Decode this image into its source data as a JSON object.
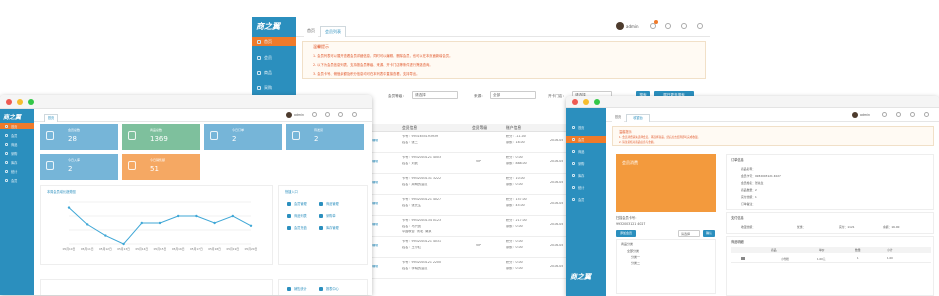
{
  "colors": {
    "sidebar": "#2b8fbe",
    "accent": "#ef7a2a",
    "blue": "#76b5d8",
    "green": "#7ec09d",
    "orange": "#f5a863",
    "red_note": "#e0572a"
  },
  "brand": "商之翼",
  "nav": [
    "首页",
    "会员",
    "商品",
    "采购",
    "库存",
    "统计",
    "会员"
  ],
  "user": "admin",
  "backwin": {
    "tabs": [
      "首页",
      "会员列表"
    ],
    "notice_title": "温馨提示",
    "notes": [
      "1. 会员列表可以展开查看会员详细信息，同时可以编辑、删除会员，也可以在本页面新增会员。",
      "2. 以下为会员信息列表，支持按会员等级、来源、开卡门店等条件进行筛选查询。",
      "3. 会员卡号、储值余额及积分信息均可在本列表中直接查看，支持导出。"
    ],
    "filters": [
      {
        "label": "会员等级：",
        "value": "请选择"
      },
      {
        "label": "来源：",
        "value": "全部"
      },
      {
        "label": "开卡门店：",
        "value": "请选择"
      }
    ],
    "search_btn": "搜索",
    "export_btn": "展开更多搜索",
    "col_headers": [
      "会员信息",
      "会员等级",
      "账户信息"
    ],
    "rows": [
      {
        "op": "编辑",
        "l1": "卡号：9931655193939",
        "l2": "姓名：张三",
        "lvl": "",
        "a1": "积分：-11.00",
        "a2": "余额：18.00",
        "t": "2016-05"
      },
      {
        "op": "编辑",
        "l1": "卡号：9932003121 4003",
        "l2": "姓名：刘武",
        "lvl": "VIP",
        "a1": "积分：0.00",
        "a2": "余额：888.00",
        "t": "2016-05"
      },
      {
        "op": "编辑",
        "l1": "卡号：9932003131 3222",
        "l2": "姓名：周明的会员",
        "lvl": "",
        "a1": "积分：10.00",
        "a2": "余额：0.00",
        "t": "2016-05"
      },
      {
        "op": "编辑",
        "l1": "卡号：9932003121 4027",
        "l2": "姓名：张先生",
        "lvl": "",
        "a1": "积分：157.00",
        "a2": "余额：45.00",
        "t": "2016-05"
      },
      {
        "op": "编辑",
        "l1": "卡号：9932003134 0123",
        "l2": "姓名：马兴武",
        "lvl": "",
        "a1": "积分：217.00",
        "a2": "余额：0.00",
        "t": "2016-05"
      },
      {
        "op": "编辑",
        "l1": "卡号：9932003121 4031",
        "l2": "姓名：王小红",
        "lvl": "VIP",
        "a1": "积分：0.00",
        "a2": "余额：0.00",
        "t": "2016-05"
      },
      {
        "op": "编辑",
        "l1": "卡号：9932003121 2200",
        "l2": "姓名：李晓的会员",
        "lvl": "",
        "a1": "积分：0.00",
        "a2": "余额：0.00",
        "t": "2016-05"
      }
    ],
    "extra_cells": [
      "中国联合",
      "河北",
      "南京"
    ]
  },
  "leftwin": {
    "tab": "首页",
    "cards": [
      {
        "label": "会员总数",
        "value": "28",
        "color": "#76b5d8"
      },
      {
        "label": "商品总数",
        "value": "1369",
        "color": "#7ec09d"
      },
      {
        "label": "今日订单",
        "value": "2",
        "color": "#76b5d8"
      },
      {
        "label": "待发货",
        "value": "2",
        "color": "#76b5d8"
      },
      {
        "label": "今日入库",
        "value": "2",
        "color": "#76b5d8"
      },
      {
        "label": "今日销售额",
        "value": "51",
        "color": "#f5a863"
      }
    ],
    "chart_title": "本周会员增长趋势图",
    "quick_title": "快捷入口",
    "quick": [
      [
        "会员管理",
        "商品管理"
      ],
      [
        "商品列表",
        "采购单"
      ],
      [
        "会员充值",
        "库存管理"
      ]
    ],
    "quick2": [
      "销售统计",
      "报表中心"
    ]
  },
  "rightwin": {
    "tabs": [
      "首页",
      "收银台"
    ],
    "notice_title": "温馨提示",
    "notes": [
      "1. 会员消费请先选择会员，再选择商品，然后点击结算即可完成收银。",
      "2. 请注意核对商品信息与金额。"
    ],
    "orange_label": "会员消费",
    "scan_label": "扫描会员卡号：",
    "card_no": "9932003121 4027",
    "small_btn": "添加会员",
    "goods_btn": "确认",
    "goods_sel": "请选择",
    "tree_title": "商品分类",
    "tree": [
      "全部分类",
      "分类一",
      "分类二"
    ],
    "info_title": "订单信息",
    "info": [
      "商品名称：",
      "会员卡号：9932003121 4027",
      "会员姓名：张先生",
      "商品数量：2",
      "实付金额：1",
      "订单备注："
    ],
    "pay_title": "支付信息",
    "pay": [
      "收银金额：",
      "优惠：",
      "实付：1121",
      "余额：16.00"
    ],
    "list_title": "商品明细",
    "list_headers": [
      "商品",
      "单价",
      "数量",
      "小计"
    ],
    "list_row": [
      "小雪糕",
      "1.00元",
      "1",
      "1.00"
    ]
  },
  "chart_data": {
    "type": "line",
    "title": "本周会员增长趋势图",
    "categories": [
      "05月10日",
      "05月11日",
      "05月12日",
      "05月13日",
      "05月14日",
      "05月15日",
      "05月16日",
      "05月17日",
      "05月18日",
      "05月19日",
      "05月20日"
    ],
    "values": [
      2.6,
      1.4,
      0.6,
      0,
      1.5,
      1.5,
      2.0,
      2.0,
      1.5,
      2.0,
      1.3
    ],
    "ylim": [
      0,
      3
    ]
  }
}
